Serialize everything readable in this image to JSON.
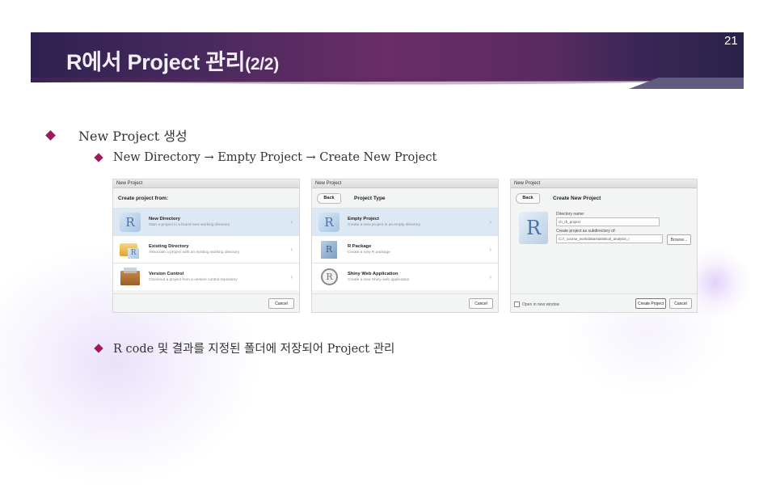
{
  "slide": {
    "title_main": "R에서 Project 관리",
    "title_suffix": "(2/2)",
    "page_number": "21"
  },
  "bullets": [
    {
      "level": 1,
      "text": "New Project 생성"
    },
    {
      "level": 2,
      "text": "New Directory → Empty Project → Create New Project"
    },
    {
      "level": 2,
      "text": "R code 및 결과를 지정된 폴더에 저장되어 Project 관리"
    }
  ],
  "dialog1": {
    "window_title": "New Project",
    "header": "Create project from:",
    "options": [
      {
        "title": "New Directory",
        "subtitle": "Start a project in a brand new working directory",
        "icon": "r-logo-icon",
        "selected": true
      },
      {
        "title": "Existing Directory",
        "subtitle": "Associate a project with an existing working directory",
        "icon": "folder-icon",
        "selected": false
      },
      {
        "title": "Version Control",
        "subtitle": "Checkout a project from a version control repository",
        "icon": "box-icon",
        "selected": false
      }
    ],
    "cancel_label": "Cancel"
  },
  "dialog2": {
    "window_title": "New Project",
    "back_label": "Back",
    "header": "Project Type",
    "options": [
      {
        "title": "Empty Project",
        "subtitle": "Create a new project in an empty directory",
        "icon": "r-logo-icon",
        "selected": true
      },
      {
        "title": "R Package",
        "subtitle": "Create a new R package",
        "icon": "r-cube-icon",
        "selected": false
      },
      {
        "title": "Shiny Web Application",
        "subtitle": "Create a new Shiny web application",
        "icon": "shiny-icon",
        "selected": false
      }
    ],
    "cancel_label": "Cancel"
  },
  "dialog3": {
    "window_title": "New Project",
    "back_label": "Back",
    "header": "Create New Project",
    "dir_name_label": "Directory name:",
    "dir_name_value": "ch_rb_project",
    "subdir_label": "Create project as subdirectory of:",
    "subdir_value": "C:/r_course_work/data/statistical_analysis_r",
    "browse_label": "Browse...",
    "open_new_window_label": "Open in new window",
    "open_new_window_checked": false,
    "create_label": "Create Project",
    "cancel_label": "Cancel"
  }
}
